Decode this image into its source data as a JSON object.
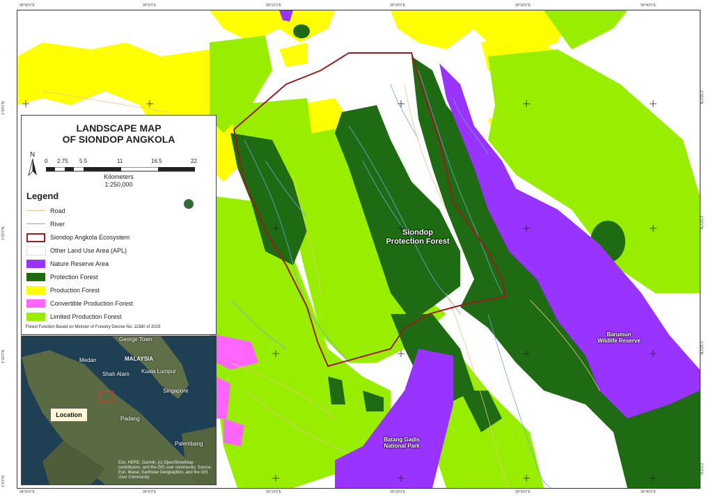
{
  "map": {
    "title_line1": "LANDSCAPE MAP",
    "title_line2": "OF SIONDOP ANGKOLA",
    "north_label": "N",
    "scale": {
      "ticks": [
        "0",
        "2.75",
        "5.5",
        "11",
        "16.5",
        "22"
      ],
      "unit": "Kilometers",
      "ratio": "1:250,000"
    },
    "legend_title": "Legend",
    "legend_items": [
      {
        "label": "Road",
        "color": "#e6c68a",
        "kind": "line"
      },
      {
        "label": "River",
        "color": "#6fa8dc",
        "kind": "line"
      },
      {
        "label": "Siondop Angkola Ecosystem",
        "color": "#9b1c1c",
        "kind": "outline"
      },
      {
        "label": "Other Land Use Area (APL)",
        "color": "#ffffff",
        "kind": "fill"
      },
      {
        "label": "Nature Reserve Area",
        "color": "#9933ff",
        "kind": "fill"
      },
      {
        "label": "Protection Forest",
        "color": "#1e6b14",
        "kind": "fill"
      },
      {
        "label": "Production Forest",
        "color": "#ffff00",
        "kind": "fill"
      },
      {
        "label": "Convertible Production Forest",
        "color": "#ff66ff",
        "kind": "fill"
      },
      {
        "label": "Limited Production Forest",
        "color": "#99ee00",
        "kind": "fill"
      }
    ],
    "note": "Forest Function Based on Minister of Forestry Decree No. 11580 of 2025",
    "labels": {
      "siondop": [
        "Siondop",
        "Protection Forest"
      ],
      "barumun": [
        "Barumun",
        "Wildlife Reserve"
      ],
      "batang": [
        "Batang Gadis",
        "National Park"
      ]
    },
    "coords_top": [
      "98°50'0\"E",
      "99°0'0\"E",
      "99°10'0\"E",
      "99°20'0\"E",
      "99°30'0\"E",
      "99°40'0\"E"
    ],
    "coords_left": [
      "1°30'0\"N",
      "1°20'0\"N",
      "1°10'0\"N",
      "1°0'0\"N"
    ],
    "inset": {
      "labels": [
        "George Town",
        "Medan",
        "MALAYSIA",
        "Shah Alam",
        "Kuala Lumpur",
        "Singapore",
        "Padang",
        "Palembang"
      ],
      "location_label": "Location",
      "credit": "Esri, HERE, Garmin, (c) OpenStreetMap contributors, and the GIS user community, Source: Esri, Maxar, Earthstar Geographics, and the GIS User Community"
    }
  }
}
